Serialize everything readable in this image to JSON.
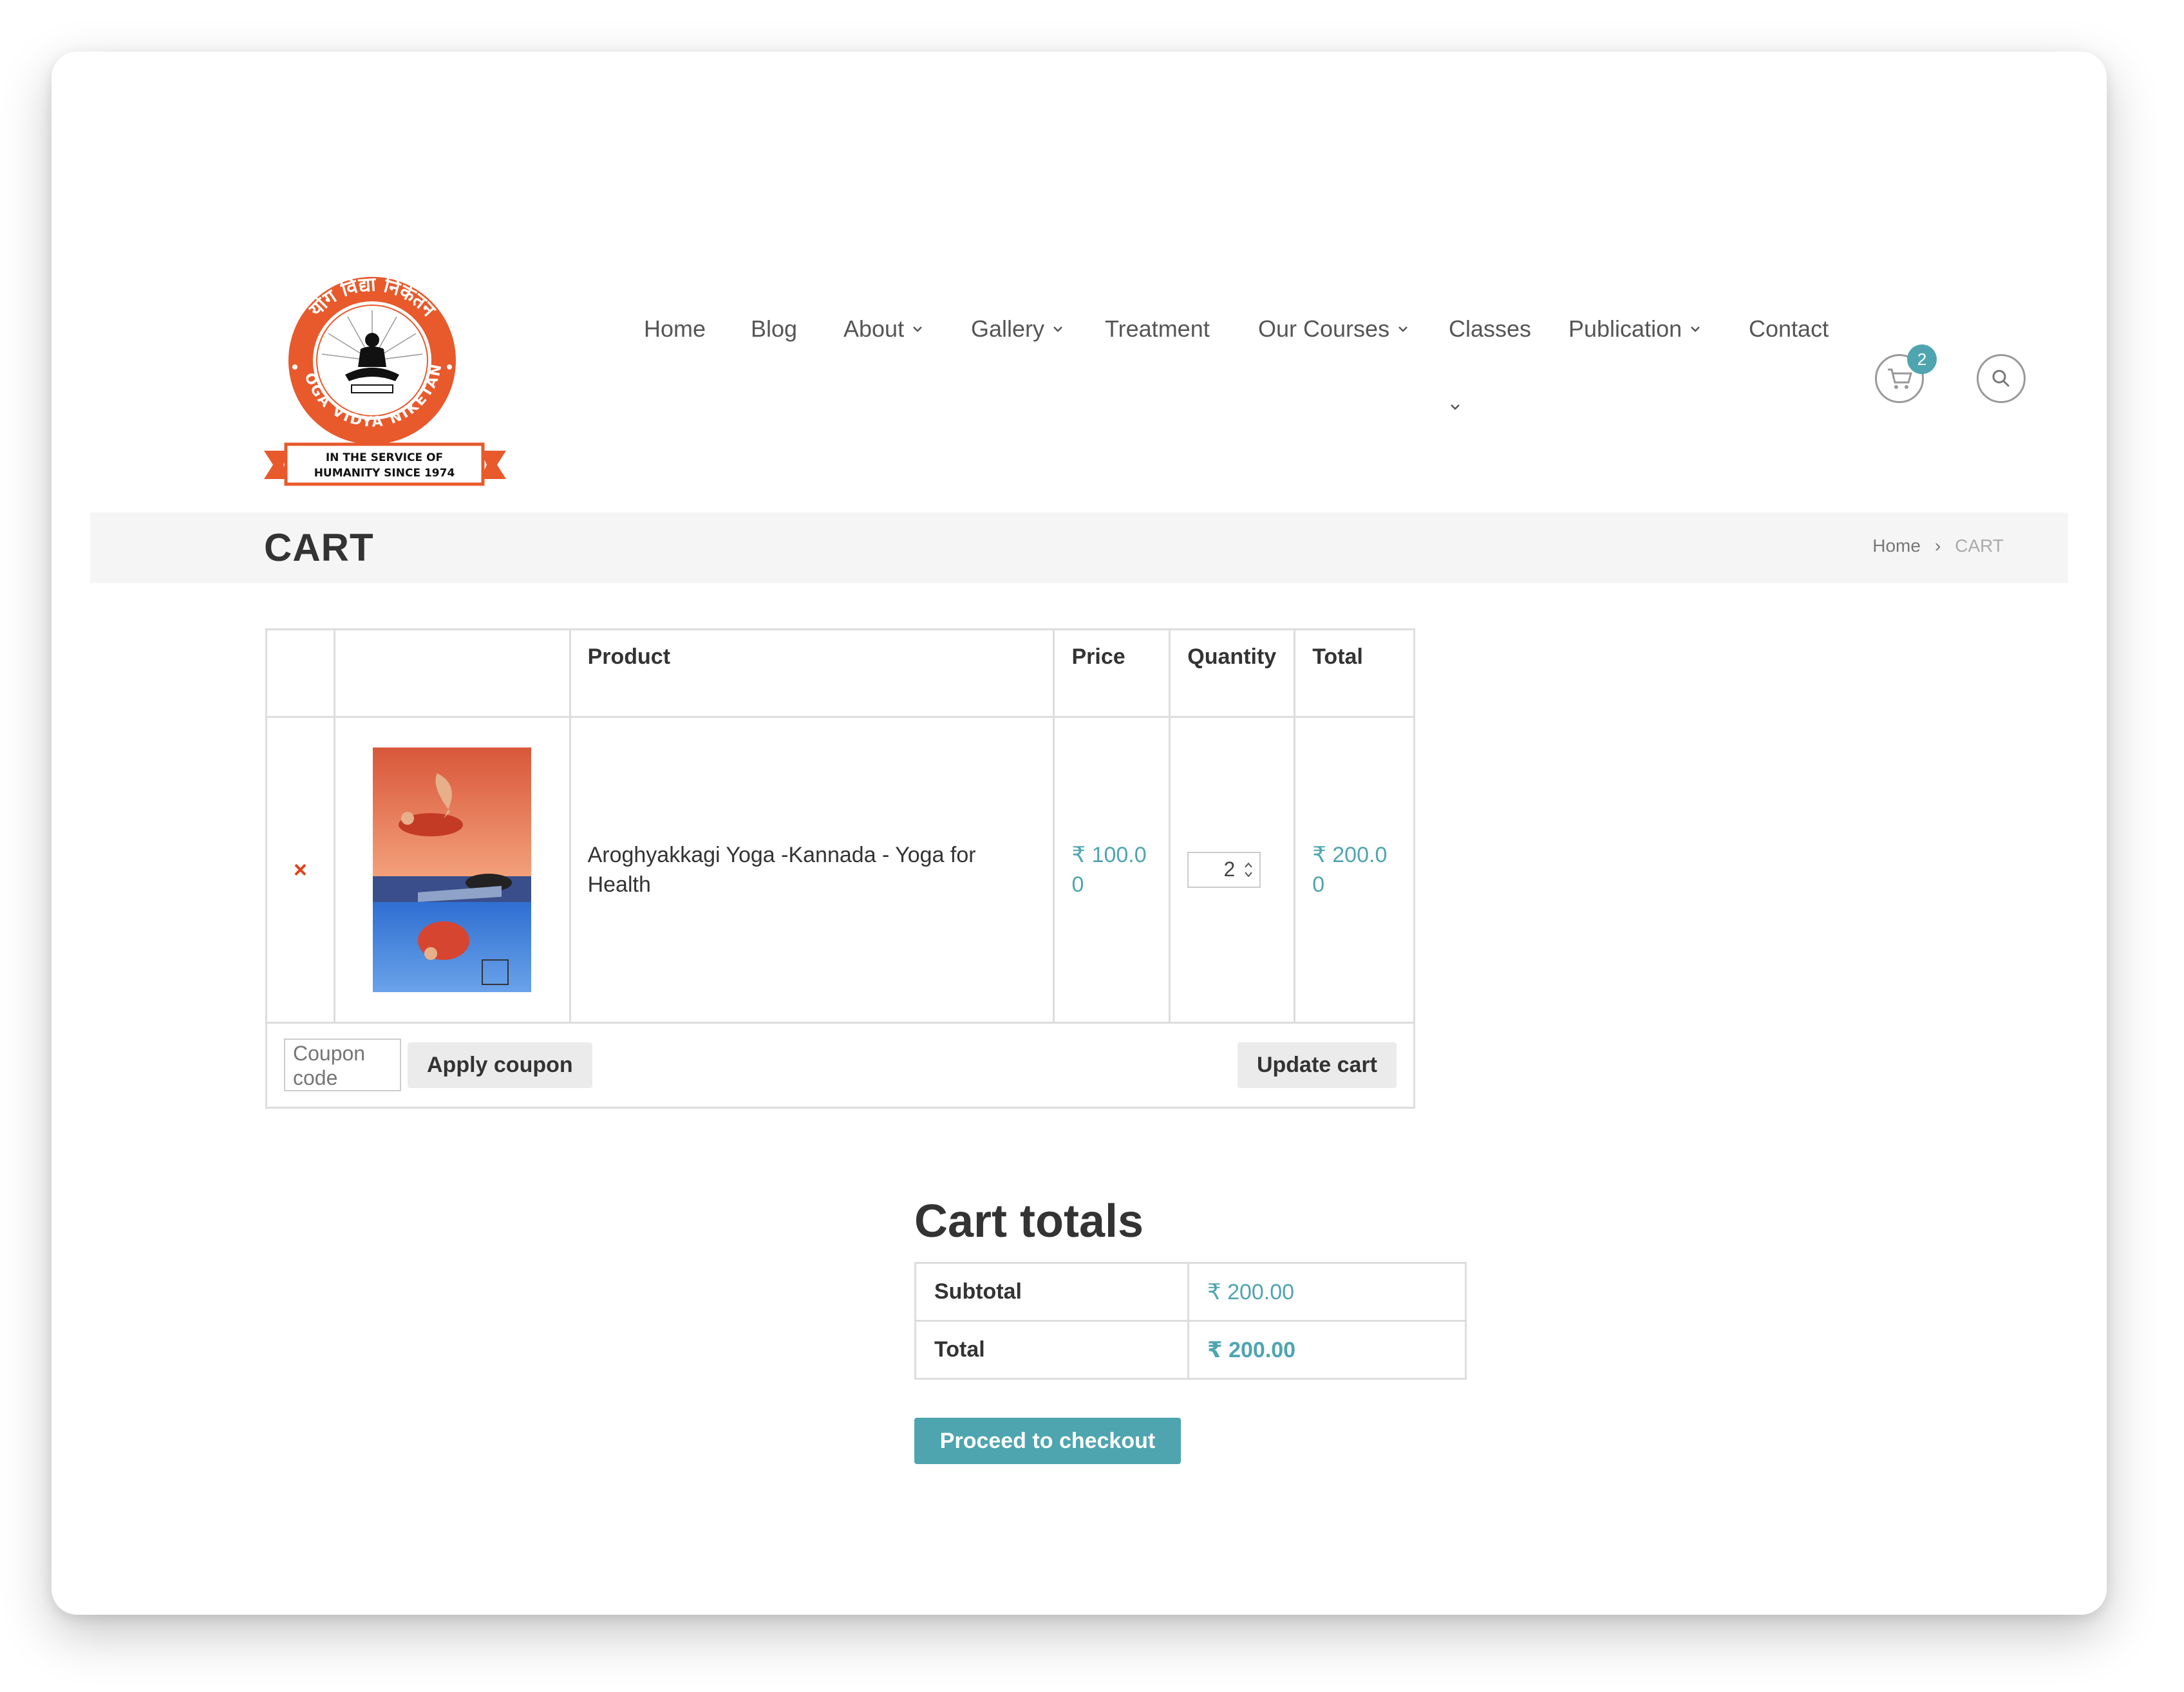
{
  "header": {
    "logo": {
      "top_arc_text": "योग विद्या निकेतन",
      "bottom_arc_text": "YOGA VIDYA NIKETAN",
      "ribbon_line1": "IN THE SERVICE OF",
      "ribbon_line2": "HUMANITY SINCE 1974",
      "colors": {
        "ring": "#e8592b",
        "ribbon": "#e8592b"
      }
    },
    "nav": [
      {
        "label": "Home",
        "dropdown": false
      },
      {
        "label": "Blog",
        "dropdown": false
      },
      {
        "label": "About",
        "dropdown": true
      },
      {
        "label": "Gallery",
        "dropdown": true
      },
      {
        "label": "Treatment",
        "dropdown": false
      },
      {
        "label": "Our Courses",
        "dropdown": true
      },
      {
        "label": "Classes",
        "dropdown": true
      },
      {
        "label": "Publication",
        "dropdown": true
      },
      {
        "label": "Contact",
        "dropdown": false
      }
    ],
    "cart_count": "2",
    "icons": {
      "cart": "cart-icon",
      "search": "search-icon"
    }
  },
  "page_title": "CART",
  "breadcrumb": {
    "home": "Home",
    "separator": "›",
    "current": "CART"
  },
  "cart": {
    "headers": {
      "product": "Product",
      "price": "Price",
      "quantity": "Quantity",
      "total": "Total"
    },
    "items": [
      {
        "remove": "×",
        "name": "Aroghyakkagi Yoga -Kannada - Yoga for Health",
        "price": "₹ 100.00",
        "quantity": "2",
        "total": "₹ 200.00"
      }
    ],
    "coupon_placeholder": "Coupon code",
    "apply_coupon": "Apply coupon",
    "update_cart": "Update cart"
  },
  "totals": {
    "title": "Cart totals",
    "subtotal_label": "Subtotal",
    "subtotal_value": "₹ 200.00",
    "total_label": "Total",
    "total_value": "₹ 200.00",
    "checkout": "Proceed to checkout"
  },
  "colors": {
    "accent": "#4ea5b0",
    "remove": "#e2401c",
    "titlebar": "#f5f5f5"
  }
}
